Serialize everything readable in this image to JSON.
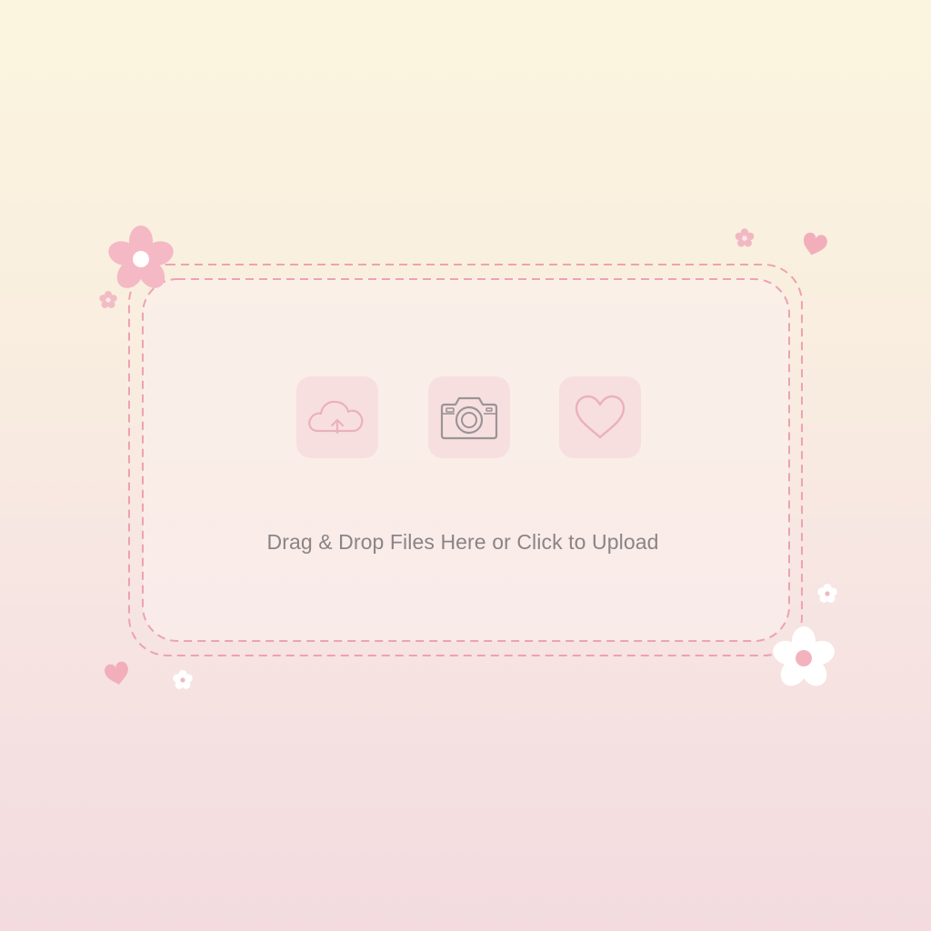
{
  "upload": {
    "prompt": "Drag & Drop Files Here or Click to Upload"
  },
  "icons": {
    "tile_1": "cloud-upload-icon",
    "tile_2": "camera-icon",
    "tile_3": "heart-icon"
  },
  "colors": {
    "dash": "#eca3b1",
    "tile_bg": "#f6dade",
    "icon_pink": "#eab1bd",
    "icon_gray": "#9a9496",
    "text": "#8b8486"
  }
}
